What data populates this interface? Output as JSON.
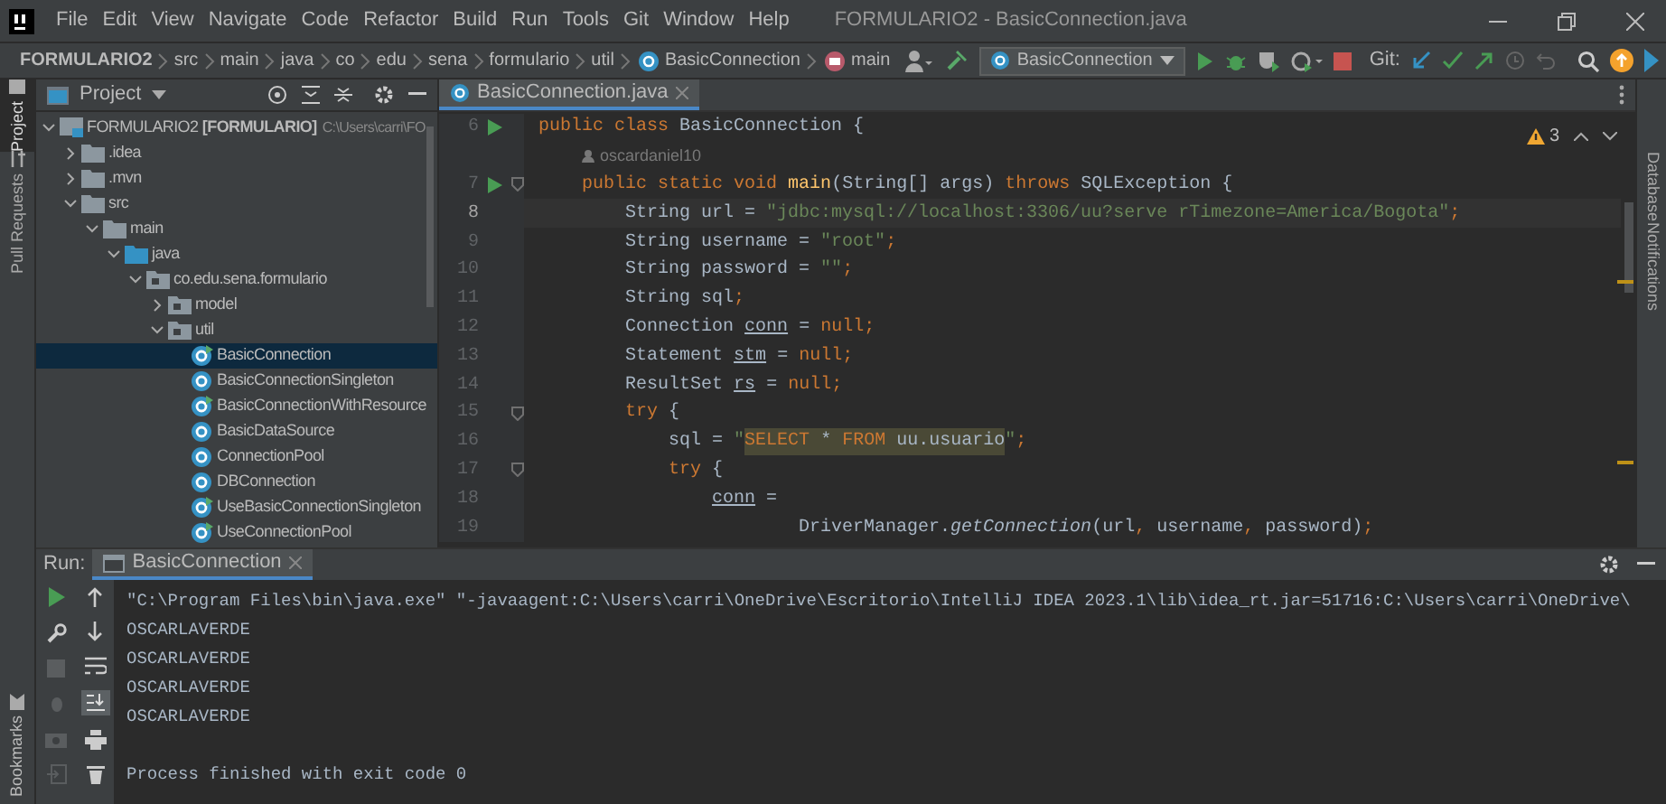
{
  "window": {
    "title": "FORMULARIO2 - BasicConnection.java"
  },
  "menu": [
    "File",
    "Edit",
    "View",
    "Navigate",
    "Code",
    "Refactor",
    "Build",
    "Run",
    "Tools",
    "Git",
    "Window",
    "Help"
  ],
  "breadcrumbs": [
    {
      "label": "FORMULARIO2",
      "kind": "project"
    },
    {
      "label": "src",
      "kind": "dir"
    },
    {
      "label": "main",
      "kind": "dir"
    },
    {
      "label": "java",
      "kind": "dir"
    },
    {
      "label": "co",
      "kind": "dir"
    },
    {
      "label": "edu",
      "kind": "dir"
    },
    {
      "label": "sena",
      "kind": "dir"
    },
    {
      "label": "formulario",
      "kind": "dir"
    },
    {
      "label": "util",
      "kind": "dir"
    },
    {
      "label": "BasicConnection",
      "kind": "class"
    },
    {
      "label": "main",
      "kind": "method"
    }
  ],
  "run_config": "BasicConnection",
  "vcs_label": "Git:",
  "left_tool_tabs": [
    {
      "label": "Project",
      "selected": true
    },
    {
      "label": "Pull Requests",
      "selected": false
    }
  ],
  "bookmarks_tab": "Bookmarks",
  "right_tool_tabs": [
    "Database",
    "Notifications"
  ],
  "project_panel": {
    "title": "Project",
    "tree": [
      {
        "label": "FORMULARIO2 **[FORMULARIO]**",
        "path": "C:\\Users\\carri\\FO",
        "kind": "module",
        "expanded": true,
        "selected": false,
        "children": [
          {
            "label": ".idea",
            "kind": "folder",
            "expanded": false,
            "selected": false
          },
          {
            "label": ".mvn",
            "kind": "folder",
            "expanded": false,
            "selected": false
          },
          {
            "label": "src",
            "kind": "folder",
            "expanded": true,
            "selected": false,
            "children": [
              {
                "label": "main",
                "kind": "folder",
                "expanded": true,
                "selected": false,
                "children": [
                  {
                    "label": "java",
                    "kind": "source",
                    "expanded": true,
                    "selected": false,
                    "children": [
                      {
                        "label": "co.edu.sena.formulario",
                        "kind": "package",
                        "expanded": true,
                        "selected": false,
                        "children": [
                          {
                            "label": "model",
                            "kind": "package",
                            "expanded": false,
                            "selected": false
                          },
                          {
                            "label": "util",
                            "kind": "package",
                            "expanded": true,
                            "selected": false,
                            "children": [
                              {
                                "label": "BasicConnection",
                                "kind": "runnable",
                                "selected": true
                              },
                              {
                                "label": "BasicConnectionSingleton",
                                "kind": "class",
                                "selected": false
                              },
                              {
                                "label": "BasicConnectionWithResource",
                                "kind": "runnable",
                                "selected": false
                              },
                              {
                                "label": "BasicDataSource",
                                "kind": "class",
                                "selected": false
                              },
                              {
                                "label": "ConnectionPool",
                                "kind": "class",
                                "selected": false
                              },
                              {
                                "label": "DBConnection",
                                "kind": "class",
                                "selected": false
                              },
                              {
                                "label": "UseBasicConnectionSingleton",
                                "kind": "runnable",
                                "selected": false
                              },
                              {
                                "label": "UseConnectionPool",
                                "kind": "runnable",
                                "selected": false
                              }
                            ]
                          }
                        ]
                      }
                    ]
                  }
                ]
              }
            ]
          }
        ]
      }
    ]
  },
  "editor": {
    "tab": {
      "label": "BasicConnection.java",
      "selected": true
    },
    "warnings": "3",
    "lines": [
      {
        "kind": "code",
        "number": "6",
        "run": true,
        "fold": false,
        "current": false,
        "tokens": [
          {
            "kind": "kw",
            "text": "public class "
          },
          {
            "kind": "plain",
            "text": "BasicConnection {"
          }
        ]
      },
      {
        "kind": "author",
        "text": "oscardaniel10"
      },
      {
        "kind": "code",
        "number": "7",
        "run": true,
        "fold": true,
        "current": false,
        "tokens": [
          {
            "kind": "kw",
            "text": "    public static void "
          },
          {
            "kind": "fn",
            "text": "main"
          },
          {
            "kind": "plain",
            "text": "(String[] args) "
          },
          {
            "kind": "kw",
            "text": "throws "
          },
          {
            "kind": "plain",
            "text": "SQLException {"
          }
        ]
      },
      {
        "kind": "code",
        "number": "8",
        "run": false,
        "fold": false,
        "current": true,
        "tokens": [
          {
            "kind": "plain",
            "text": "        String url = "
          },
          {
            "kind": "str",
            "text": "\"jdbc:mysql://localhost:3306/uu?serve rTimezone=America/Bogota\""
          },
          {
            "kind": "kw",
            "text": ";"
          }
        ]
      },
      {
        "kind": "code",
        "number": "9",
        "run": false,
        "fold": false,
        "current": false,
        "tokens": [
          {
            "kind": "plain",
            "text": "        String username = "
          },
          {
            "kind": "str",
            "text": "\"root\""
          },
          {
            "kind": "kw",
            "text": ";"
          }
        ]
      },
      {
        "kind": "code",
        "number": "10",
        "run": false,
        "fold": false,
        "current": false,
        "tokens": [
          {
            "kind": "plain",
            "text": "        String password = "
          },
          {
            "kind": "str",
            "text": "\"\""
          },
          {
            "kind": "kw",
            "text": ";"
          }
        ]
      },
      {
        "kind": "code",
        "number": "11",
        "run": false,
        "fold": false,
        "current": false,
        "tokens": [
          {
            "kind": "plain",
            "text": "        String sql"
          },
          {
            "kind": "kw",
            "text": ";"
          }
        ]
      },
      {
        "kind": "code",
        "number": "12",
        "run": false,
        "fold": false,
        "current": false,
        "tokens": [
          {
            "kind": "plain",
            "text": "        Connection "
          },
          {
            "kind": "var",
            "text": "conn"
          },
          {
            "kind": "plain",
            "text": " = "
          },
          {
            "kind": "kw",
            "text": "null;"
          }
        ]
      },
      {
        "kind": "code",
        "number": "13",
        "run": false,
        "fold": false,
        "current": false,
        "tokens": [
          {
            "kind": "plain",
            "text": "        Statement "
          },
          {
            "kind": "var",
            "text": "stm"
          },
          {
            "kind": "plain",
            "text": " = "
          },
          {
            "kind": "kw",
            "text": "null;"
          }
        ]
      },
      {
        "kind": "code",
        "number": "14",
        "run": false,
        "fold": false,
        "current": false,
        "tokens": [
          {
            "kind": "plain",
            "text": "        ResultSet "
          },
          {
            "kind": "var",
            "text": "rs"
          },
          {
            "kind": "plain",
            "text": " = "
          },
          {
            "kind": "kw",
            "text": "null;"
          }
        ]
      },
      {
        "kind": "code",
        "number": "15",
        "run": false,
        "fold": true,
        "current": false,
        "tokens": [
          {
            "kind": "kw",
            "text": "        try "
          },
          {
            "kind": "plain",
            "text": "{"
          }
        ]
      },
      {
        "kind": "code",
        "number": "16",
        "run": false,
        "fold": false,
        "current": false,
        "tokens": [
          {
            "kind": "plain",
            "text": "            sql = "
          },
          {
            "kind": "str",
            "text": "\""
          },
          {
            "kind": "sqlkw",
            "text": "SELECT "
          },
          {
            "kind": "sql",
            "text": "* "
          },
          {
            "kind": "sqlkw",
            "text": "FROM "
          },
          {
            "kind": "sql",
            "text": "uu.usuario"
          },
          {
            "kind": "str",
            "text": "\""
          },
          {
            "kind": "kw",
            "text": ";"
          }
        ]
      },
      {
        "kind": "code",
        "number": "17",
        "run": false,
        "fold": true,
        "current": false,
        "tokens": [
          {
            "kind": "kw",
            "text": "            try "
          },
          {
            "kind": "plain",
            "text": "{"
          }
        ]
      },
      {
        "kind": "code",
        "number": "18",
        "run": false,
        "fold": false,
        "current": false,
        "tokens": [
          {
            "kind": "var",
            "text": "                conn"
          },
          {
            "kind": "plain",
            "text": " ="
          }
        ]
      },
      {
        "kind": "code",
        "number": "19",
        "run": false,
        "fold": false,
        "current": false,
        "tokens": [
          {
            "kind": "plain",
            "text": "                        DriverManager."
          },
          {
            "kind": "italic",
            "text": "getConnection"
          },
          {
            "kind": "plain",
            "text": "(url"
          },
          {
            "kind": "kw",
            "text": ","
          },
          {
            "kind": "plain",
            "text": " username"
          },
          {
            "kind": "kw",
            "text": ","
          },
          {
            "kind": "plain",
            "text": " password)"
          },
          {
            "kind": "kw",
            "text": ";"
          }
        ]
      }
    ]
  },
  "run_panel": {
    "label": "Run:",
    "tab": {
      "label": "BasicConnection",
      "selected": true
    },
    "console": [
      {
        "kind": "command",
        "text": "\"C:\\Program Files\\bin\\java.exe\" \"-javaagent:C:\\Users\\carri\\OneDrive\\Escritorio\\IntelliJ IDEA 2023.1\\lib\\idea_rt.jar=51716:C:\\Users\\carri\\OneDrive\\"
      },
      {
        "kind": "output",
        "text": "OSCARLAVERDE"
      },
      {
        "kind": "output",
        "text": "OSCARLAVERDE"
      },
      {
        "kind": "output",
        "text": "OSCARLAVERDE"
      },
      {
        "kind": "output",
        "text": "OSCARLAVERDE"
      },
      {
        "kind": "blank"
      },
      {
        "kind": "status",
        "text": "Process finished with exit code 0"
      }
    ]
  }
}
